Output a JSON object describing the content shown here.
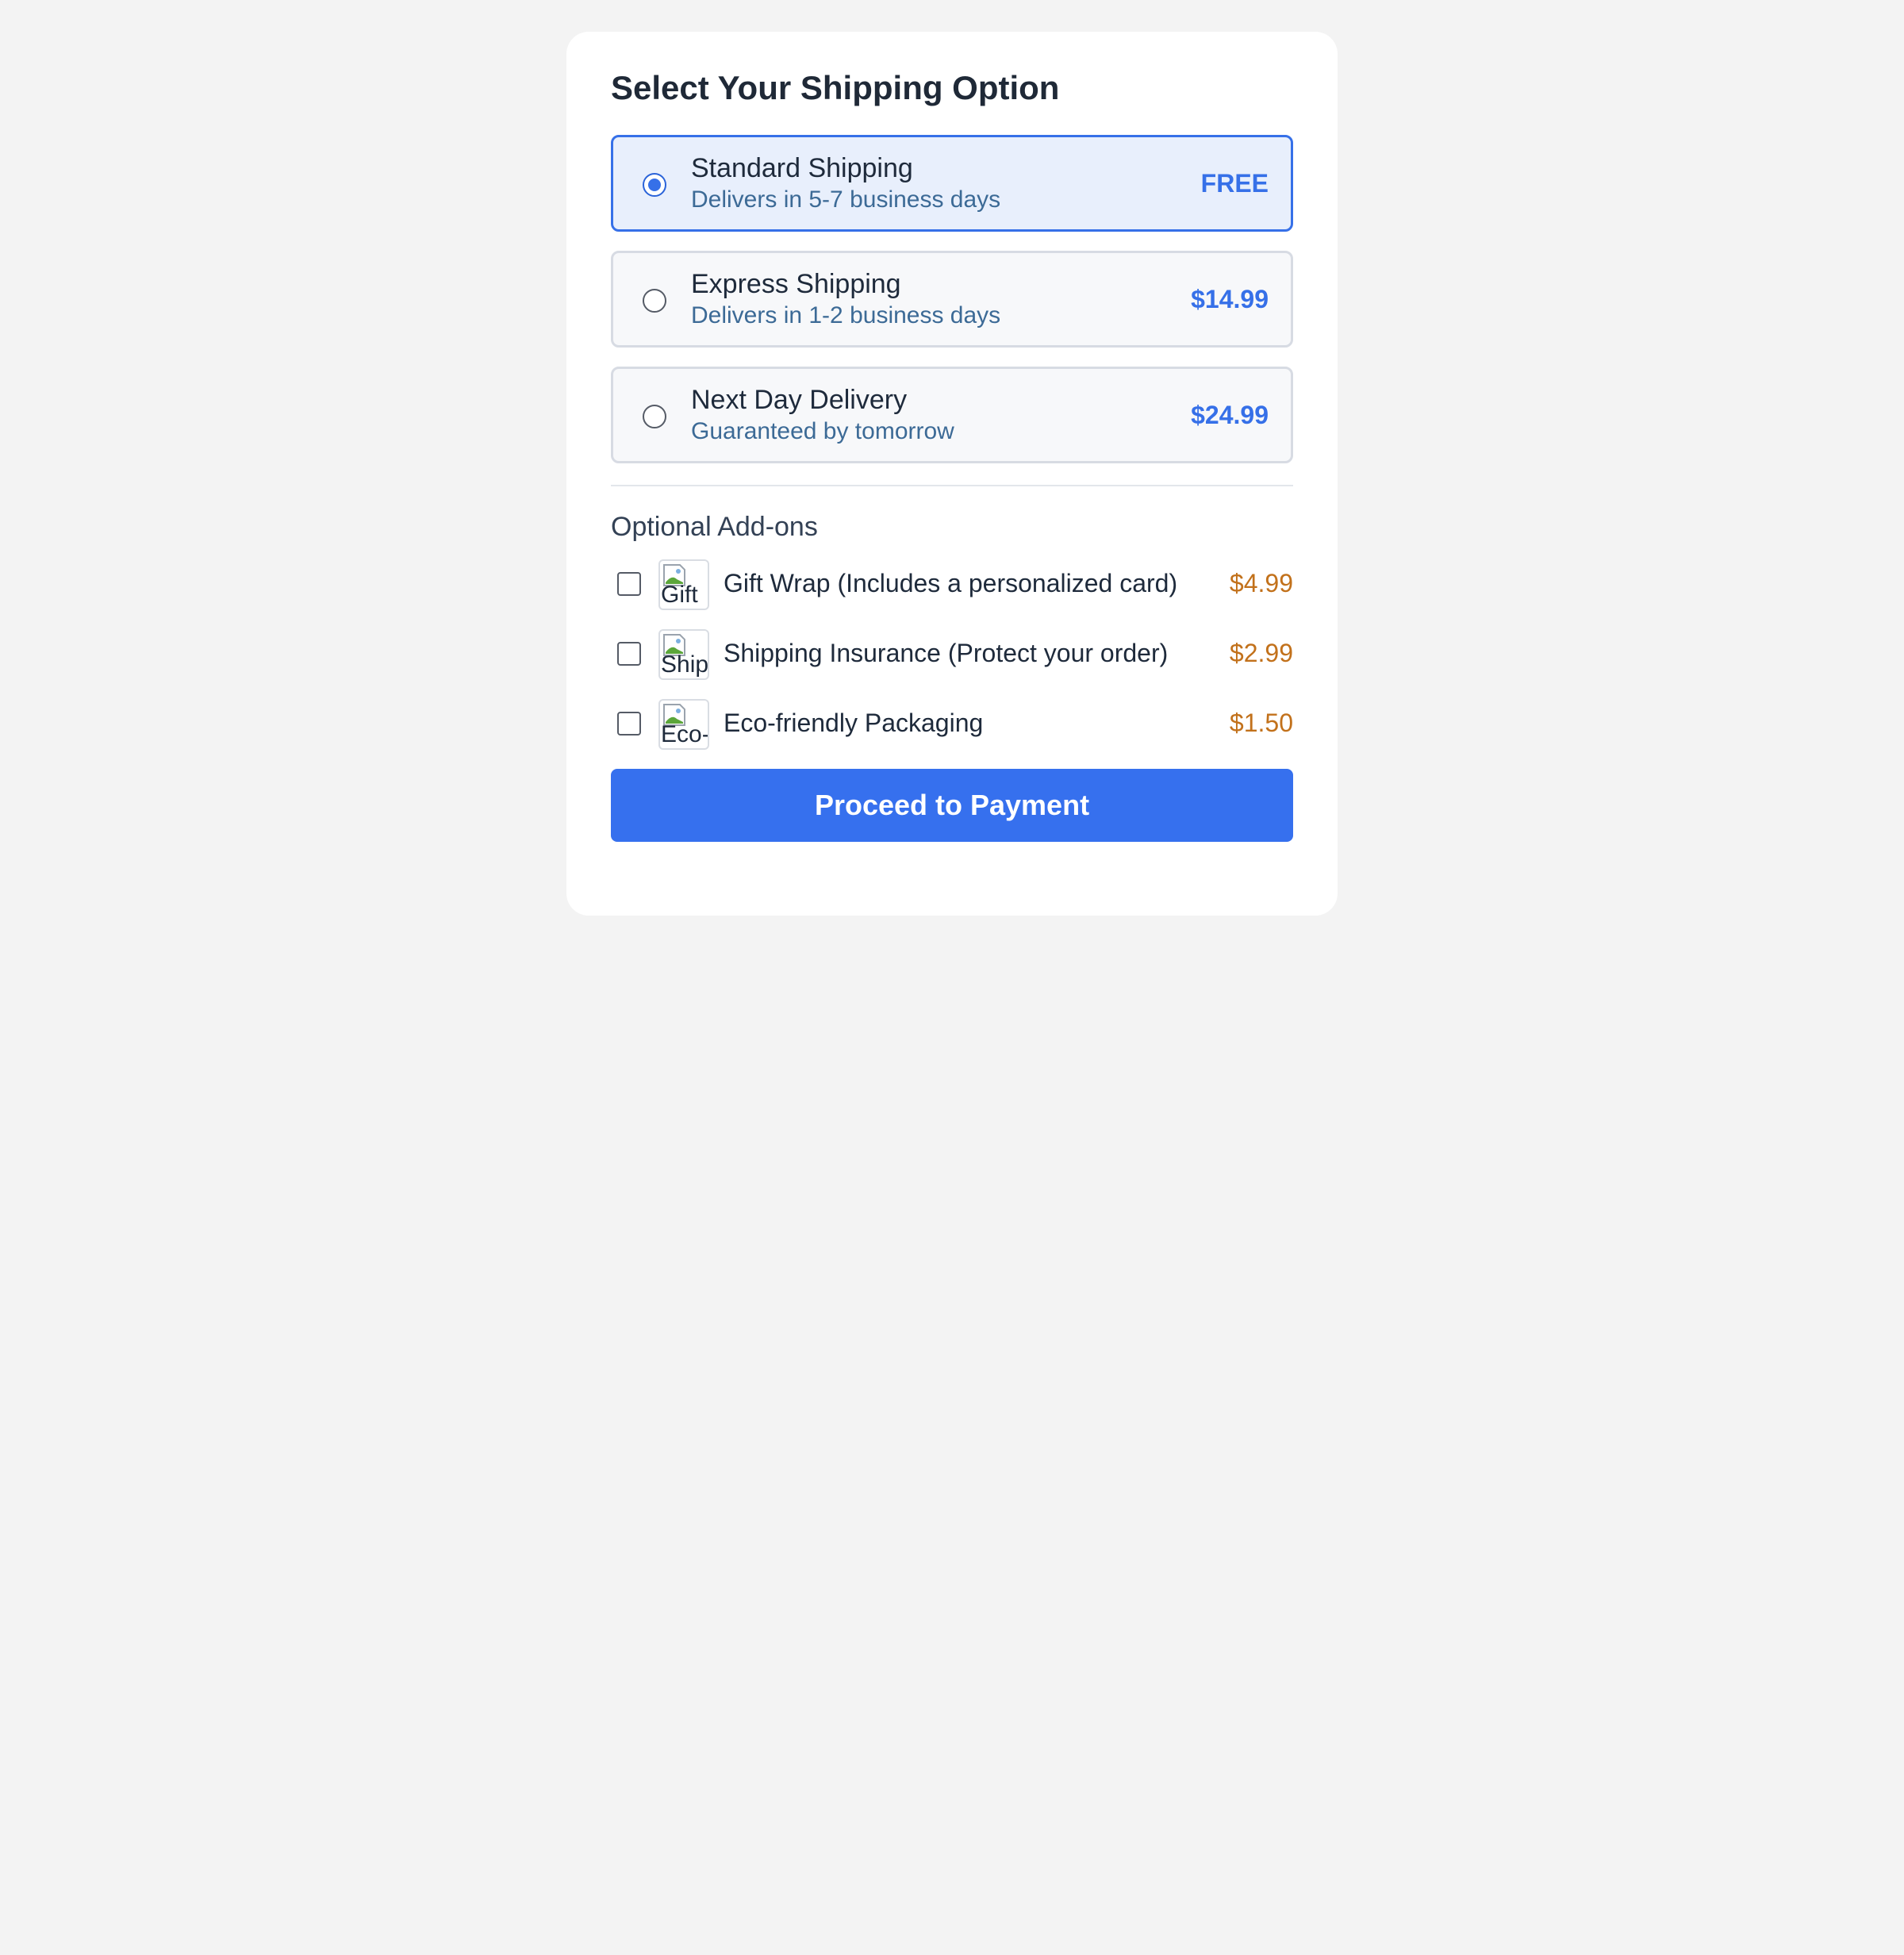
{
  "title": "Select Your Shipping Option",
  "shipping_options": [
    {
      "name": "Standard Shipping",
      "description": "Delivers in 5-7 business days",
      "price": "FREE",
      "selected": true
    },
    {
      "name": "Express Shipping",
      "description": "Delivers in 1-2 business days",
      "price": "$14.99",
      "selected": false
    },
    {
      "name": "Next Day Delivery",
      "description": "Guaranteed by tomorrow",
      "price": "$24.99",
      "selected": false
    }
  ],
  "addons_title": "Optional Add-ons",
  "addons": [
    {
      "image_alt": "Gift",
      "label": "Gift Wrap (Includes a personalized card)",
      "price": "$4.99",
      "checked": false
    },
    {
      "image_alt": "Ship",
      "label": "Shipping Insurance (Protect your order)",
      "price": "$2.99",
      "checked": false
    },
    {
      "image_alt": "Eco-",
      "label": "Eco-friendly Packaging",
      "price": "$1.50",
      "checked": false
    }
  ],
  "proceed_button": "Proceed to Payment",
  "colors": {
    "accent": "#3670e8",
    "addon_price": "#c2711b",
    "selected_background": "#e8effc",
    "page_background": "#f3f3f3"
  }
}
